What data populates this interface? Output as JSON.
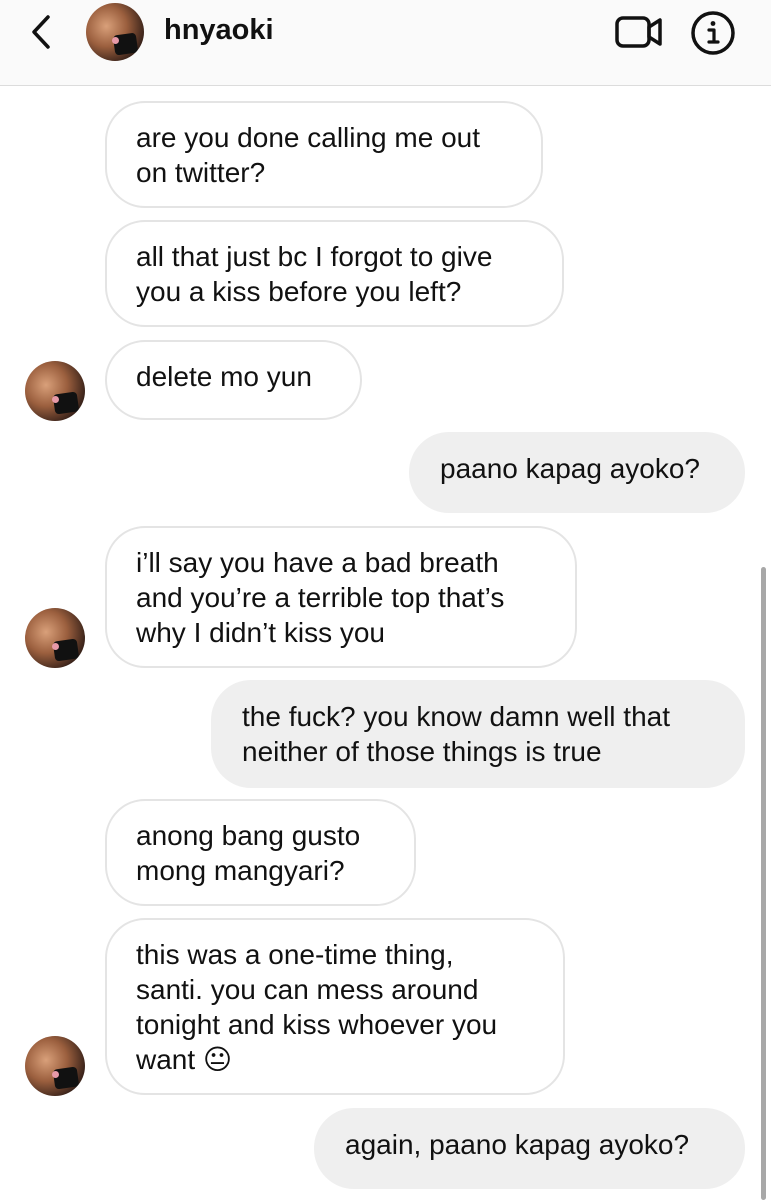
{
  "header": {
    "username": "hnyaoki"
  },
  "messages": [
    {
      "direction": "incoming",
      "text": "are you done calling me out\non twitter?"
    },
    {
      "direction": "incoming",
      "text": "all that just bc I forgot to give\nyou a kiss before you left?"
    },
    {
      "direction": "incoming",
      "text": "delete mo yun"
    },
    {
      "direction": "outgoing",
      "text": "paano kapag ayoko?"
    },
    {
      "direction": "incoming",
      "text": "i’ll say you have a bad breath\nand you’re a terrible top that’s\nwhy I didn’t kiss you"
    },
    {
      "direction": "outgoing",
      "text": "the fuck? you know damn well that\nneither of those things is true"
    },
    {
      "direction": "incoming",
      "text": "anong bang gusto\nmong mangyari?"
    },
    {
      "direction": "incoming",
      "text": "this was a one-time thing,\nsanti. you can mess around\ntonight and kiss whoever you\nwant 😐"
    },
    {
      "direction": "outgoing",
      "text": "again, paano kapag ayoko?"
    }
  ],
  "colors": {
    "outgoing_bubble": "#efefef",
    "incoming_border": "#e4e4e4",
    "header_bg": "#fafafa"
  },
  "icons": [
    "chevron-left-icon",
    "video-camera-icon",
    "info-icon"
  ]
}
